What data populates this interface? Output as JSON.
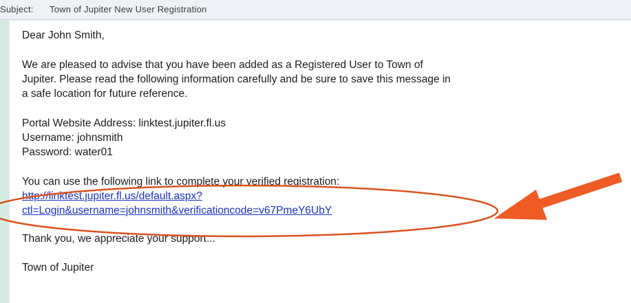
{
  "email": {
    "subject_label": "Subject:",
    "subject": "Town of Jupiter New User Registration",
    "greeting": "Dear John Smith,",
    "paragraph_lines": [
      "We are pleased to advise that you have been added as a Registered User to Town of",
      "Jupiter. Please read the following information carefully and be sure to save this message in",
      "a safe location for future reference."
    ],
    "portal_line": "Portal Website Address: linktest.jupiter.fl.us",
    "username_line": "Username: johnsmith",
    "password_line": "Password: water01",
    "link_intro": "You can use the following link to complete your verified registration:",
    "link_lines": [
      "http://linktest.jupiter.fl.us/default.aspx?",
      "ctl=Login&username=johnsmith&verificationcode=v67PmeY6UbY"
    ],
    "thanks": "Thank you, we appreciate your support...",
    "signature": "Town of Jupiter"
  },
  "colors": {
    "annotation": "#d9531e",
    "link": "#1a30c9"
  }
}
